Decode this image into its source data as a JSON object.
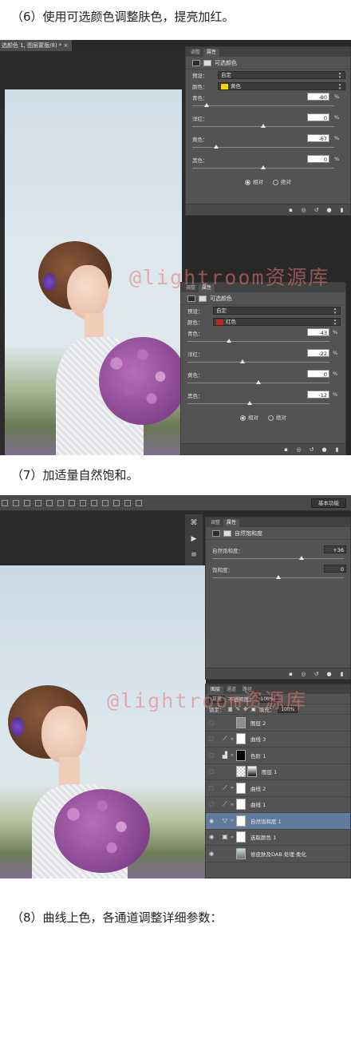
{
  "step6": {
    "heading": "（6）使用可选颜色调整肤色，提亮加红。",
    "doc_tab": "选颜色 1, 图层蒙版/8) * ×",
    "panel1": {
      "tabs": [
        "调整",
        "属性"
      ],
      "title": "可选颜色",
      "preset_label": "预设：",
      "preset_value": "自定",
      "color_label": "颜色：",
      "color_value": "黄色",
      "swatch_color": "#f2d400",
      "sliders": [
        {
          "label": "青色：",
          "value": "-80",
          "pct": "%",
          "fraction": 0.1
        },
        {
          "label": "洋红：",
          "value": "0",
          "pct": "%",
          "fraction": 0.5
        },
        {
          "label": "黄色：",
          "value": "-67",
          "pct": "%",
          "fraction": 0.17
        },
        {
          "label": "黑色：",
          "value": "0",
          "pct": "%",
          "fraction": 0.5
        }
      ],
      "radio_relative": "相对",
      "radio_absolute": "绝对"
    },
    "panel2": {
      "tabs": [
        "调整",
        "属性"
      ],
      "title": "可选颜色",
      "preset_label": "预设：",
      "preset_value": "自定",
      "color_label": "颜色：",
      "color_value": "红色",
      "swatch_color": "#c0281c",
      "sliders": [
        {
          "label": "青色：",
          "value": "-43",
          "pct": "%",
          "fraction": 0.29
        },
        {
          "label": "洋红：",
          "value": "-22",
          "pct": "%",
          "fraction": 0.39
        },
        {
          "label": "黄色：",
          "value": "0",
          "pct": "%",
          "fraction": 0.5
        },
        {
          "label": "黑色：",
          "value": "-12",
          "pct": "%",
          "fraction": 0.44
        }
      ],
      "radio_relative": "相对",
      "radio_absolute": "绝对"
    },
    "watermark": "@lightroom资源库"
  },
  "step7": {
    "heading": "（7）加适量自然饱和。",
    "workspace": "基本功能",
    "panel": {
      "tabs": [
        "调整",
        "属性"
      ],
      "title": "自然饱和度",
      "sliders": [
        {
          "label": "自然饱和度：",
          "value": "+36",
          "fraction": 0.68
        },
        {
          "label": "饱和度：",
          "value": "0",
          "fraction": 0.5
        }
      ]
    },
    "layers": {
      "tabs": [
        "图层",
        "通道",
        "路径"
      ],
      "blend_mode": "正常",
      "opacity_label": "不透明度：",
      "opacity_value": "100%",
      "lock_label": "锁定：",
      "fill_label": "填充：",
      "fill_value": "100%",
      "items": [
        {
          "name": "图层 2",
          "visible": false,
          "icon": "",
          "thumb": "gray",
          "selected": false
        },
        {
          "name": "曲线 3",
          "visible": false,
          "icon": "curves",
          "thumb": "white",
          "selected": false
        },
        {
          "name": "色阶 1",
          "visible": false,
          "icon": "levels",
          "thumb": "black",
          "selected": false
        },
        {
          "name": "图层 1",
          "visible": false,
          "icon": "",
          "thumb": "checker",
          "selected": false
        },
        {
          "name": "曲线 2",
          "visible": false,
          "icon": "curves",
          "thumb": "white",
          "selected": false
        },
        {
          "name": "曲线 1",
          "visible": false,
          "icon": "curves",
          "thumb": "white",
          "selected": false
        },
        {
          "name": "自然饱和度 1",
          "visible": true,
          "icon": "vibrance",
          "thumb": "white",
          "selected": true
        },
        {
          "name": "选取颜色 1",
          "visible": true,
          "icon": "selective",
          "thumb": "white",
          "selected": false
        },
        {
          "name": "修皮肤及DAB 处理 柔化",
          "visible": true,
          "icon": "",
          "thumb": "photo",
          "selected": false
        }
      ]
    },
    "watermark": "@lightroom资源库"
  },
  "step8": {
    "heading": "（8）曲线上色，各通道调整详细参数："
  }
}
